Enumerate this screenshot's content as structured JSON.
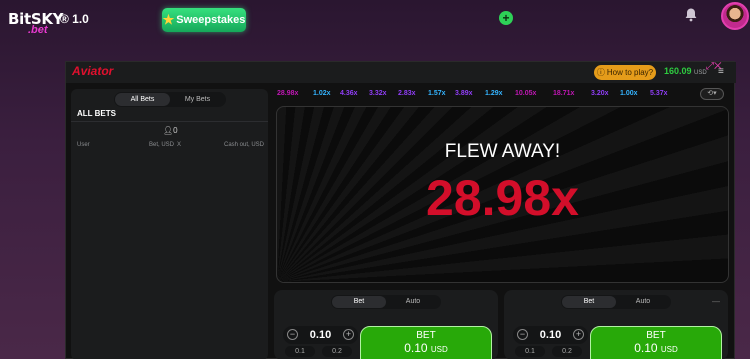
{
  "site": {
    "logo_main": "BitSKY",
    "logo_version": "® 1.0",
    "logo_sub": ".bet",
    "sweepstakes_label": "Sweepstakes"
  },
  "icons": {
    "star": "star-icon",
    "plus": "plus-icon",
    "bell": "bell-icon",
    "avatar": "user-avatar",
    "user": "user-icon",
    "history": "history-icon",
    "menu": "menu-icon",
    "minus": "minus-icon"
  },
  "game": {
    "name": "Aviator",
    "how_to_play": "How to play?",
    "balance": "160.09",
    "currency": "USD"
  },
  "bets_panel": {
    "tabs": [
      "All Bets",
      "My Bets"
    ],
    "title": "ALL BETS",
    "count": "0",
    "columns": {
      "user": "User",
      "bet": "Bet, USD",
      "x": "X",
      "cashout": "Cash out, USD"
    }
  },
  "history": [
    {
      "value": "28.98x",
      "color": "#c017b4"
    },
    {
      "value": "1.02x",
      "color": "#34b4ff"
    },
    {
      "value": "4.36x",
      "color": "#913ef8"
    },
    {
      "value": "3.32x",
      "color": "#913ef8"
    },
    {
      "value": "2.83x",
      "color": "#913ef8"
    },
    {
      "value": "1.57x",
      "color": "#34b4ff"
    },
    {
      "value": "3.89x",
      "color": "#913ef8"
    },
    {
      "value": "1.29x",
      "color": "#34b4ff"
    },
    {
      "value": "10.05x",
      "color": "#c017b4"
    },
    {
      "value": "18.71x",
      "color": "#c017b4"
    },
    {
      "value": "3.20x",
      "color": "#913ef8"
    },
    {
      "value": "1.00x",
      "color": "#34b4ff"
    },
    {
      "value": "5.37x",
      "color": "#913ef8"
    }
  ],
  "screen": {
    "flew_text": "FLEW AWAY!",
    "multiplier": "28.98x"
  },
  "bet_panels": [
    {
      "tabs": [
        "Bet",
        "Auto"
      ],
      "amount": "0.10",
      "quick": [
        "0.1",
        "0.2"
      ],
      "button_label": "BET",
      "button_amount": "0.10",
      "button_currency": "USD"
    },
    {
      "tabs": [
        "Bet",
        "Auto"
      ],
      "amount": "0.10",
      "quick": [
        "0.1",
        "0.2"
      ],
      "button_label": "BET",
      "button_amount": "0.10",
      "button_currency": "USD"
    }
  ],
  "colors": {
    "accent_red": "#d30e2a",
    "bet_green": "#28a909",
    "balance_green": "#2ecc40",
    "how_to_orange": "#e59c1a"
  }
}
